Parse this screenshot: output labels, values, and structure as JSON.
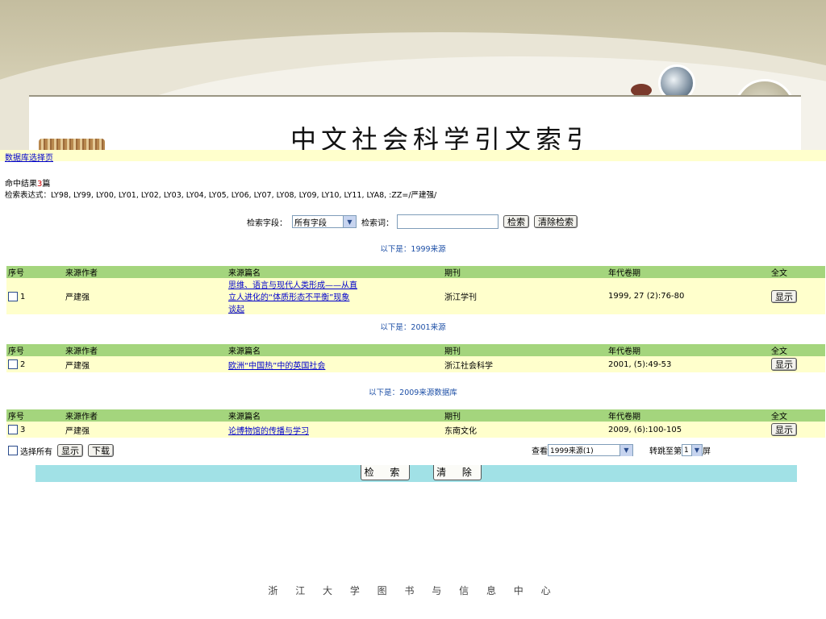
{
  "banner": {
    "title": "中文社会科学引文索引"
  },
  "nav": {
    "db_select_link": "数据库选择页"
  },
  "results": {
    "hits_prefix": "命中结果",
    "hits_count": "3",
    "hits_suffix": "篇",
    "expr_label": "检索表达式：",
    "expr_value": "LY98, LY99, LY00, LY01, LY02, LY03, LY04, LY05, LY06, LY07, LY08, LY09, LY10, LY11, LYA8, :ZZ=/严建强/"
  },
  "search": {
    "field_label": "检索字段：",
    "field_value": "所有字段",
    "term_label": "检索词：",
    "term_value": "",
    "search_button": "检索",
    "clear_button": "清除检索"
  },
  "columns": [
    "序号",
    "来源作者",
    "来源篇名",
    "期刊",
    "年代卷期",
    "全文"
  ],
  "sections": [
    {
      "heading": "以下是：1999来源",
      "rows": [
        {
          "no": "1",
          "author": "严建强",
          "title_lines": [
            "思维、语言与现代人类形成——从直",
            "立人进化的“体质形态不平衡”现象",
            "谈起"
          ],
          "journal": "浙江学刊",
          "issue": "1999, 27 (2):76-80",
          "fulltext_button": "显示"
        }
      ]
    },
    {
      "heading": "以下是：2001来源",
      "rows": [
        {
          "no": "2",
          "author": "严建强",
          "title_lines": [
            "欧洲“中国热”中的英国社会"
          ],
          "journal": "浙江社会科学",
          "issue": "2001, (5):49-53",
          "fulltext_button": "显示"
        }
      ]
    },
    {
      "heading": "以下是：2009来源数据库",
      "rows": [
        {
          "no": "3",
          "author": "严建强",
          "title_lines": [
            "论博物馆的传播与学习"
          ],
          "journal": "东南文化",
          "issue": "2009, (6):100-105",
          "fulltext_button": "显示"
        }
      ]
    }
  ],
  "footer_controls": {
    "select_all_label": "选择所有",
    "show_button": "显示",
    "download_button": "下载",
    "view_label": "查看",
    "view_value": "1999来源(1)",
    "jump_prefix": "转跳至第",
    "jump_value": "1",
    "jump_suffix": "屏"
  },
  "bottom_buttons": {
    "search": "检 索",
    "clear": "清 除"
  },
  "org_footer": "浙 江 大 学 图 书 与 信 息 中 心"
}
